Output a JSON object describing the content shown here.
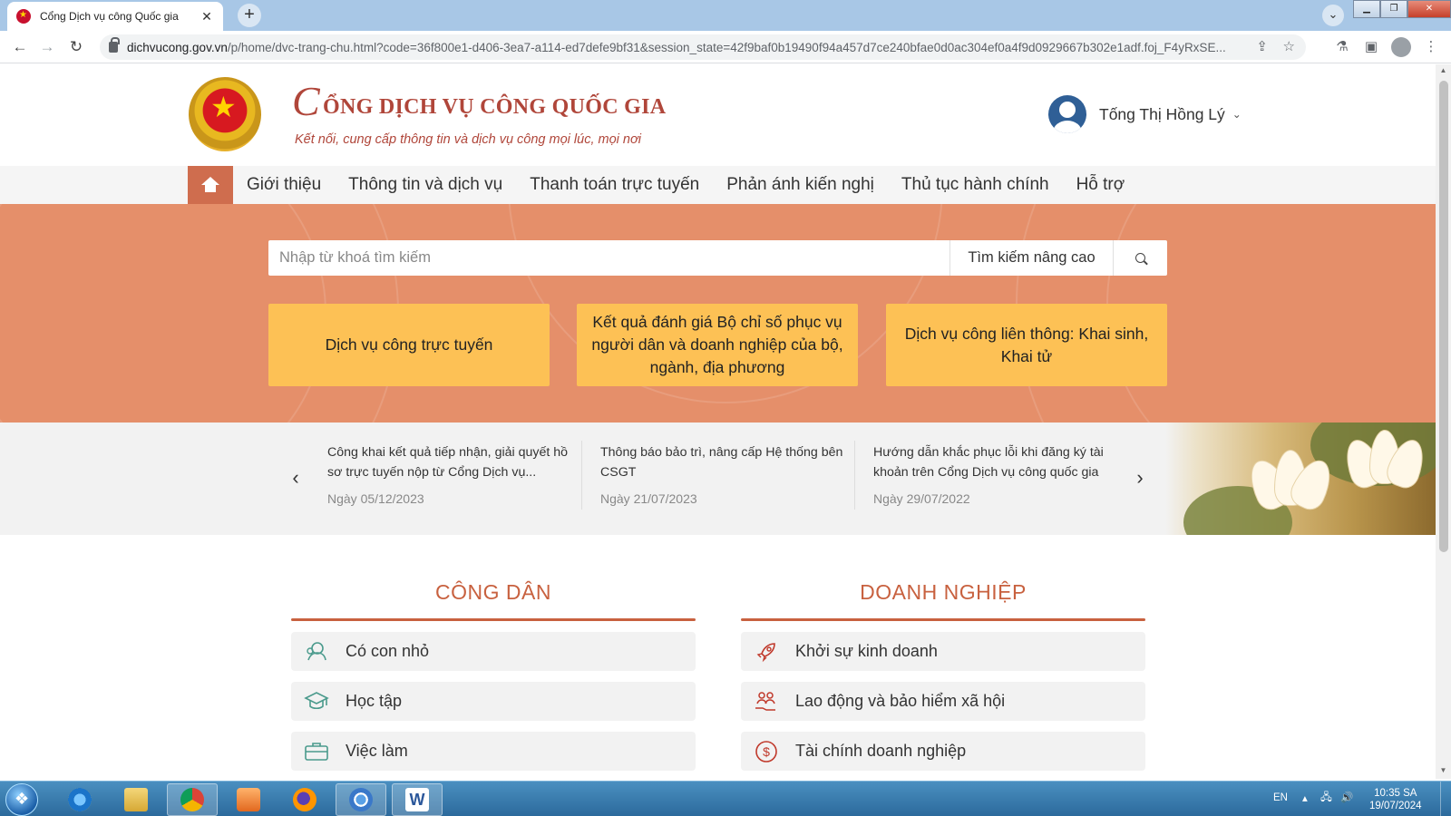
{
  "browser": {
    "tab_title": "Cổng Dịch vụ công Quốc gia",
    "tab_close": "✕",
    "new_tab": "+",
    "url_host": "dichvucong.gov.vn",
    "url_path": "/p/home/dvc-trang-chu.html?code=36f800e1-d406-3ea7-a114-ed7defe9bf31&session_state=42f9baf0b19490f94a457d7ce240bfae0d0ac304ef0a4f9d0929667b302e1adf.foj_F4yRxSE..."
  },
  "site": {
    "brand_mark": "C",
    "title": "ỔNG DỊCH VỤ CÔNG QUỐC GIA",
    "slogan": "Kết nối, cung cấp thông tin và dịch vụ công mọi lúc, mọi nơi",
    "user_name": "Tống Thị Hồng Lý",
    "user_caret": "⌄"
  },
  "nav": {
    "items": [
      "Giới thiệu",
      "Thông tin và dịch vụ",
      "Thanh toán trực tuyến",
      "Phản ánh kiến nghị",
      "Thủ tục hành chính",
      "Hỗ trợ"
    ]
  },
  "search": {
    "placeholder": "Nhập từ khoá tìm kiếm",
    "advanced_label": "Tìm kiếm nâng cao"
  },
  "hero_cards": [
    "Dịch vụ công trực tuyến",
    "Kết quả đánh giá Bộ chỉ số phục vụ người dân và doanh nghiệp của bộ, ngành, địa phương",
    "Dịch vụ công liên thông: Khai sinh, Khai tử"
  ],
  "news": {
    "prev": "‹",
    "next": "›",
    "items": [
      {
        "title": "Công khai kết quả tiếp nhận, giải quyết hồ sơ trực tuyến nộp từ Cổng Dịch vụ...",
        "date": "Ngày 05/12/2023"
      },
      {
        "title": "Thông báo bảo trì, nâng cấp Hệ thống bên CSGT",
        "date": "Ngày 21/07/2023"
      },
      {
        "title": "Hướng dẫn khắc phục lỗi khi đăng ký tài khoản trên Cổng Dịch vụ công quốc gia",
        "date": "Ngày 29/07/2022"
      }
    ]
  },
  "citizen": {
    "heading": "CÔNG DÂN",
    "items": [
      {
        "label": "Có con nhỏ",
        "icon": "baby-icon"
      },
      {
        "label": "Học tập",
        "icon": "graduation-cap-icon"
      },
      {
        "label": "Việc làm",
        "icon": "briefcase-icon"
      }
    ]
  },
  "business": {
    "heading": "DOANH NGHIỆP",
    "items": [
      {
        "label": "Khởi sự kinh doanh",
        "icon": "rocket-icon"
      },
      {
        "label": "Lao động và bảo hiểm xã hội",
        "icon": "people-hand-icon"
      },
      {
        "label": "Tài chính doanh nghiệp",
        "icon": "dollar-coin-icon"
      }
    ]
  },
  "taskbar": {
    "language": "EN",
    "time": "10:35 SA",
    "date": "19/07/2024"
  },
  "colors": {
    "accent": "#c8613f",
    "hero_bg": "#e58f6a",
    "card_bg": "#fdc155",
    "brand": "#b0463a"
  }
}
